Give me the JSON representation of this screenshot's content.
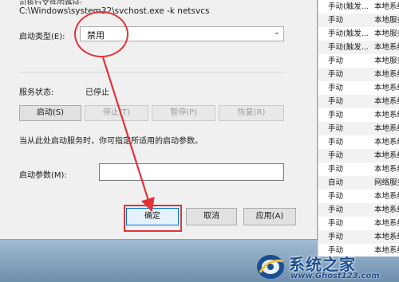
{
  "dialog": {
    "executable_path": "C:\\Windows\\system32\\svchost.exe -k netsvcs",
    "startup_type_label": "启动类型(E):",
    "startup_type_value": "禁用",
    "service_status_label": "服务状态:",
    "service_status_value": "已停止",
    "buttons": {
      "start": "启动(S)",
      "stop": "停止(T)",
      "pause": "暂停(P)",
      "resume": "恢复(R)"
    },
    "hint_text": "当从此处启动服务时，你可指定所适用的启动参数。",
    "start_params_label": "启动参数(M):",
    "start_params_value": "",
    "footer": {
      "ok": "确定",
      "cancel": "取消",
      "apply": "应用(A)"
    }
  },
  "services_list": {
    "rows": [
      {
        "startup": "手动(触发...",
        "logon": "本地系统"
      },
      {
        "startup": "手动",
        "logon": "本地服务"
      },
      {
        "startup": "手动(触发...",
        "logon": "本地服务"
      },
      {
        "startup": "手动(触发...",
        "logon": "本地系统"
      },
      {
        "startup": "手动",
        "logon": "本地服务"
      },
      {
        "startup": "手动",
        "logon": "本地系统"
      },
      {
        "startup": "手动",
        "logon": "本地系统"
      },
      {
        "startup": "手动",
        "logon": "本地系统"
      },
      {
        "startup": "手动",
        "logon": "本地系统"
      },
      {
        "startup": "手动",
        "logon": "本地系统"
      },
      {
        "startup": "手动",
        "logon": "本地系统"
      },
      {
        "startup": "手动",
        "logon": "本地系统"
      },
      {
        "startup": "手动",
        "logon": "本地系统"
      },
      {
        "startup": "自动",
        "logon": "网络服务"
      },
      {
        "startup": "手动",
        "logon": "本地系统"
      },
      {
        "startup": "手动",
        "logon": "本地系统"
      },
      {
        "startup": "手动",
        "logon": "本地系统"
      },
      {
        "startup": "手动",
        "logon": "本地系统"
      },
      {
        "startup": "手动",
        "logon": "本地系统"
      }
    ]
  },
  "watermark": {
    "title": "系统之家",
    "url": "www.Ghost123.com"
  },
  "colors": {
    "annotation": "#e0343a",
    "primary_border": "#0078d7",
    "watermark": "#1b4f8f"
  }
}
